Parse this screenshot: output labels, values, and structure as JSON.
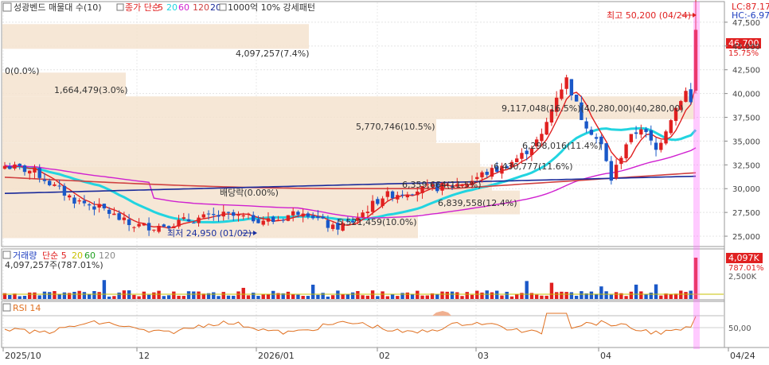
{
  "header": {
    "title": "성광벤드 매물대 수(10)",
    "items": [
      {
        "label": "종가 단순",
        "color": "#e02020"
      },
      {
        "label": "5",
        "color": "#e02020"
      },
      {
        "label": "20",
        "color": "#22d4e0"
      },
      {
        "label": "60",
        "color": "#d020d0"
      },
      {
        "label": "120",
        "color": "#d04040"
      },
      {
        "label": "200",
        "color": "#1a2a9a"
      },
      {
        "label": "1000억 10% 강세패턴",
        "color": "#333333"
      }
    ],
    "lc": "LC:87.17",
    "hc": "HC:-6.97"
  },
  "chart_data": [
    {
      "type": "candlestick",
      "name": "price",
      "x_ticks": [
        "2025/10",
        "12",
        "2026/01",
        "02",
        "03",
        "04",
        "04/24"
      ],
      "y_ticks": [
        25000,
        27500,
        30000,
        32500,
        35000,
        37500,
        40000,
        42500,
        45000,
        47500
      ],
      "y_range": [
        24000,
        49500
      ],
      "last_price_label": "46,700",
      "last_change_label": "15.75%",
      "annotations": {
        "high": "최고 50,200 (04/24)",
        "low": "최저 24,950 (01/02)",
        "dividend": "배당락(0.00%)"
      },
      "volume_profile": [
        {
          "label": "4,097,257(7.4%)"
        },
        {
          "label": "0(0.0%)"
        },
        {
          "label": "1,664,479(3.0%)"
        },
        {
          "label": "9,117,048(16.5%)(40,280,00)(40,280,00)"
        },
        {
          "label": "5,770,746(10.5%)"
        },
        {
          "label": "6,298,016(11.4%)"
        },
        {
          "label": "6,430,777(11.6%)"
        },
        {
          "label": "6,359,664(11.5%)"
        },
        {
          "label": "6,839,558(12.4%)"
        },
        {
          "label": "5,521,459(10.0%)"
        }
      ]
    },
    {
      "type": "bar",
      "name": "volume",
      "title": "거래량",
      "legend": [
        {
          "label": "단순 5",
          "color": "#e02020"
        },
        {
          "label": "20",
          "color": "#c8c000"
        },
        {
          "label": "60",
          "color": "#20a020"
        },
        {
          "label": "120",
          "color": "#888888"
        }
      ],
      "info": "4,097,257주(787.01%)",
      "y_ticks": [
        "2,500K"
      ],
      "last_label": "4,097K",
      "last_pct": "787.01%"
    },
    {
      "type": "line",
      "name": "rsi",
      "title": "RSI 14",
      "y_ticks": [
        "50,00"
      ]
    }
  ]
}
